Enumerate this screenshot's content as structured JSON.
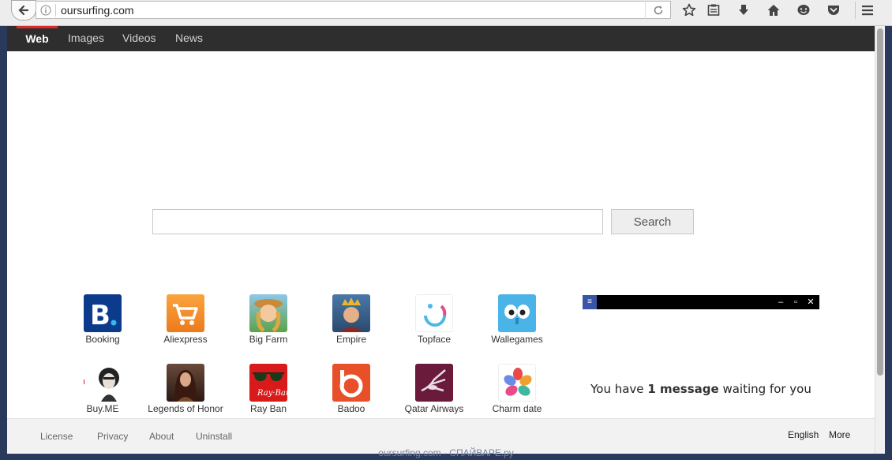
{
  "browser": {
    "url": "oursurfing.com",
    "icons": [
      "back-arrow-icon",
      "info-icon",
      "reload-icon",
      "star-icon",
      "reading-list-icon",
      "download-icon",
      "home-icon",
      "chat-icon",
      "pocket-icon",
      "hamburger-menu-icon"
    ]
  },
  "nav": {
    "tabs": [
      "Web",
      "Images",
      "Videos",
      "News"
    ],
    "active": "Web"
  },
  "search": {
    "value": "",
    "placeholder": "",
    "button_label": "Search"
  },
  "tiles": [
    {
      "label": "Booking"
    },
    {
      "label": "Aliexpress"
    },
    {
      "label": "Big Farm"
    },
    {
      "label": "Empire"
    },
    {
      "label": "Topface"
    },
    {
      "label": "Wallegames"
    },
    {
      "label": "Buy.ME"
    },
    {
      "label": "Legends of Honor"
    },
    {
      "label": "Ray Ban"
    },
    {
      "label": "Badoo"
    },
    {
      "label": "Qatar Airways"
    },
    {
      "label": "Charm date"
    }
  ],
  "promo": {
    "text_before": "You have ",
    "highlight": "1 message",
    "text_after": " waiting for you"
  },
  "footer": {
    "links": [
      "License",
      "Privacy",
      "About",
      "Uninstall"
    ],
    "language": "English",
    "more": "More"
  },
  "watermark": "oursurfing.com - СПАЙВАРЕ.ру",
  "colors": {
    "nav_bg": "#2e2e2e",
    "active_tab_accent": "#d92b2b",
    "promo_menu": "#3a55a8"
  }
}
